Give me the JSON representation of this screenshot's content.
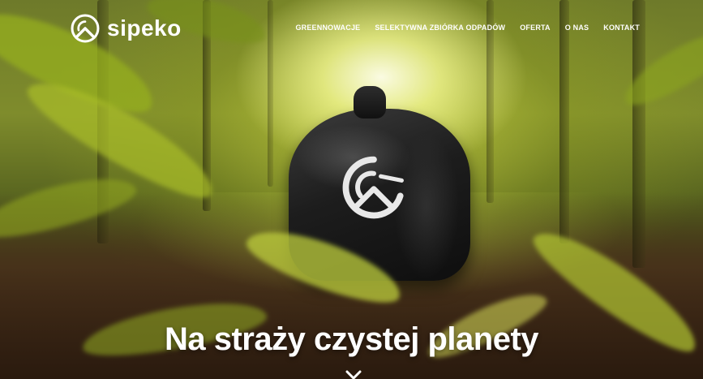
{
  "brand": {
    "name": "sipeko",
    "logo_icon": "sipeko-logo-icon"
  },
  "nav": {
    "items": [
      {
        "label": "GREENNOWACJE"
      },
      {
        "label": "SELEKTYWNA ZBIÓRKA ODPADÓW"
      },
      {
        "label": "OFERTA"
      },
      {
        "label": "O NAS"
      },
      {
        "label": "KONTAKT"
      }
    ]
  },
  "hero": {
    "headline": "Na straży czystej planety",
    "scroll_icon": "chevron-down-icon",
    "image_subject": "trash-bag-with-logo-in-forest"
  },
  "colors": {
    "text": "#ffffff",
    "accent": "#c8d23c"
  }
}
